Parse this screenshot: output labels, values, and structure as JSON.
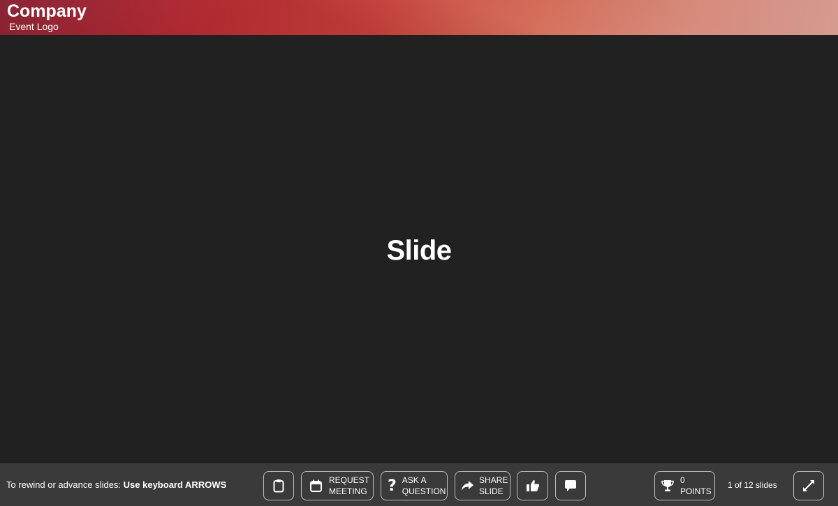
{
  "header": {
    "company": "Company",
    "subtitle": "Event Logo"
  },
  "slide": {
    "title": "Slide"
  },
  "toolbar": {
    "hint_prefix": "To rewind or advance slides: ",
    "hint_bold": "Use keyboard ARROWS",
    "request_meeting": [
      "REQUEST",
      "MEETING"
    ],
    "ask_question": [
      "ASK A",
      "QUESTION"
    ],
    "share_slide": [
      "SHARE",
      "SLIDE"
    ],
    "points_value": "0",
    "points_label": "POINTS",
    "pager": "1 of 12 slides"
  },
  "icons": {
    "clipboard": "clipboard-icon",
    "calendar": "calendar-icon",
    "question": "question-icon",
    "share": "share-arrow-icon",
    "like": "thumbs-up-icon",
    "comment": "comment-icon",
    "trophy": "trophy-icon",
    "fullscreen": "expand-icon"
  },
  "colors": {
    "header_start": "#8c1a2c",
    "header_end": "#d59a8f",
    "stage_bg": "#212121",
    "toolbar_bg": "#3a3a3a"
  }
}
